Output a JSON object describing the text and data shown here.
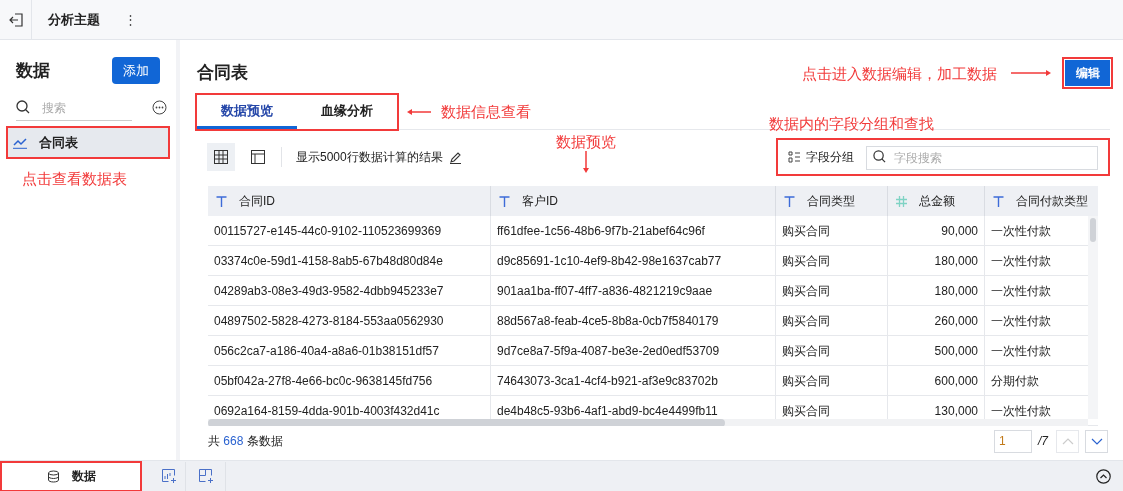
{
  "top_bar": {
    "title": "分析主题",
    "menu": "⋮"
  },
  "sidebar": {
    "title": "数据",
    "add_button": "添加",
    "search": {
      "placeholder": "搜索"
    },
    "items": [
      {
        "label": "合同表",
        "selected": true
      }
    ]
  },
  "main": {
    "title": "合同表",
    "edit_button": "编辑",
    "tabs": [
      {
        "label": "数据预览",
        "selected": true
      },
      {
        "label": "血缘分析",
        "selected": false
      }
    ],
    "toolbar": {
      "views": [
        {
          "kind": "grid",
          "selected": true
        },
        {
          "kind": "layout",
          "selected": false
        }
      ],
      "note": "显示5000行数据计算的结果",
      "group_button": "字段分组",
      "search": {
        "placeholder": "字段搜索"
      }
    },
    "table": {
      "columns": [
        {
          "label": "合同ID",
          "kind": "text"
        },
        {
          "label": "客户ID",
          "kind": "text"
        },
        {
          "label": "合同类型",
          "kind": "text"
        },
        {
          "label": "总金额",
          "kind": "number"
        },
        {
          "label": "合同付款类型",
          "kind": "text"
        }
      ],
      "rows": [
        [
          "00115727-e145-44c0-9102-110523699369",
          "ff61dfee-1c56-48b6-9f7b-21abef64c96f",
          "购买合同",
          "90,000",
          "一次性付款"
        ],
        [
          "03374c0e-59d1-4158-8ab5-67b48d80d84e",
          "d9c85691-1c10-4ef9-8b42-98e1637cab77",
          "购买合同",
          "180,000",
          "一次性付款"
        ],
        [
          "04289ab3-08e3-49d3-9582-4dbb945233e7",
          "901aa1ba-ff07-4ff7-a836-4821219c9aae",
          "购买合同",
          "180,000",
          "一次性付款"
        ],
        [
          "04897502-5828-4273-8184-553aa0562930",
          "88d567a8-feab-4ce5-8b8a-0cb7f5840179",
          "购买合同",
          "260,000",
          "一次性付款"
        ],
        [
          "056c2ca7-a186-40a4-a8a6-01b38151df57",
          "9d7ce8a7-5f9a-4087-be3e-2ed0edf53709",
          "购买合同",
          "500,000",
          "一次性付款"
        ],
        [
          "05bf042a-27f8-4e66-bc0c-9638145fd756",
          "74643073-3ca1-4cf4-b921-af3e9c83702b",
          "购买合同",
          "600,000",
          "分期付款"
        ],
        [
          "0692a164-8159-4dda-901b-4003f432d41c",
          "de4b48c5-93b6-4af1-abd9-bc4e4499fb11",
          "购买合同",
          "130,000",
          "一次性付款"
        ]
      ]
    },
    "footer": {
      "prefix": "共",
      "count": "668",
      "suffix": "条数据",
      "page": "1",
      "pages": "/7",
      "prev_disabled": true,
      "next_disabled": false
    }
  },
  "bottom_bar": {
    "tabs": [
      {
        "label": "数据",
        "selected": true
      }
    ]
  },
  "annotations": [
    {
      "text": "点击查看数据表",
      "kind": "plain"
    },
    {
      "text": "数据信息查看",
      "kind": "left_arrow"
    },
    {
      "text": "点击进入数据编辑，加工数据",
      "kind": "right_arrow"
    },
    {
      "text": "数据内的字段分组和查找",
      "kind": "plain"
    },
    {
      "text": "数据预览",
      "kind": "down_arrow"
    }
  ]
}
